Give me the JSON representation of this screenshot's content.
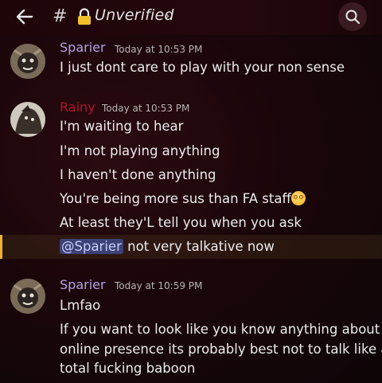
{
  "header": {
    "channel_prefix": "#",
    "channel_name": "Unverified",
    "chevron": "›",
    "icons": {
      "back": "arrow-left-icon",
      "lock": "lock-icon",
      "search": "search-icon"
    }
  },
  "messages": [
    {
      "author": "Sparier",
      "author_color": "#b5a0e8",
      "timestamp": "Today at 10:53 PM",
      "lines": [
        "I just dont care to play with your non sense"
      ]
    },
    {
      "author": "Rainy",
      "author_color": "#b0132b",
      "timestamp": "Today at 10:53 PM",
      "lines": [
        "I'm waiting to hear",
        "I'm not playing anything",
        "I haven't done anything",
        "You're being more sus than FA staff",
        "At least they'L tell you when you ask"
      ],
      "mention": "@Sparier",
      "mention_text": " not very talkative now"
    },
    {
      "author": "Sparier",
      "author_color": "#b5a0e8",
      "timestamp": "Today at 10:59 PM",
      "lines": [
        "Lmfao",
        "If you want to look like you know anything about",
        "online presence its probably best not to talk like a",
        "total fucking baboon"
      ]
    }
  ]
}
